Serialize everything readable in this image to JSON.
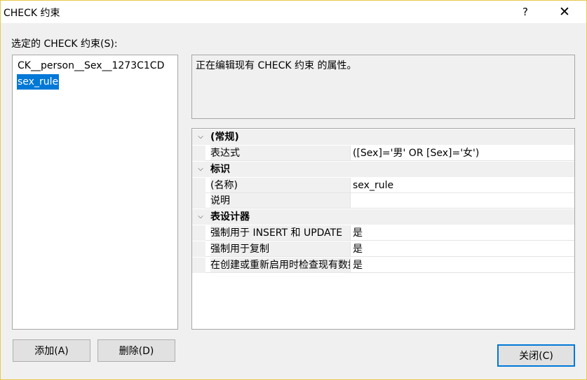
{
  "window": {
    "title": "CHECK 约束",
    "help_glyph": "?",
    "close_glyph": "✕"
  },
  "list": {
    "caption": "选定的 CHECK 约束(S):",
    "items": [
      {
        "label": "CK__person__Sex__1273C1CD",
        "selected": false
      },
      {
        "label": "sex_rule",
        "selected": true
      }
    ]
  },
  "description": "正在编辑现有 CHECK 约束 的属性。",
  "grid": {
    "categories": [
      {
        "label": "(常规)",
        "expanded": true,
        "props": [
          {
            "name": "表达式",
            "value": "([Sex]='男' OR [Sex]='女')"
          }
        ]
      },
      {
        "label": "标识",
        "expanded": true,
        "props": [
          {
            "name": "(名称)",
            "value": "sex_rule"
          },
          {
            "name": "说明",
            "value": ""
          }
        ]
      },
      {
        "label": "表设计器",
        "expanded": true,
        "props": [
          {
            "name": "强制用于 INSERT 和 UPDATE",
            "value": "是"
          },
          {
            "name": "强制用于复制",
            "value": "是"
          },
          {
            "name": "在创建或重新启用时检查现有数据",
            "value": "是"
          }
        ]
      }
    ]
  },
  "buttons": {
    "add": "添加(A)",
    "delete": "删除(D)",
    "close": "关闭(C)"
  },
  "icons": {
    "expand_caret": "chevron-down-icon"
  }
}
